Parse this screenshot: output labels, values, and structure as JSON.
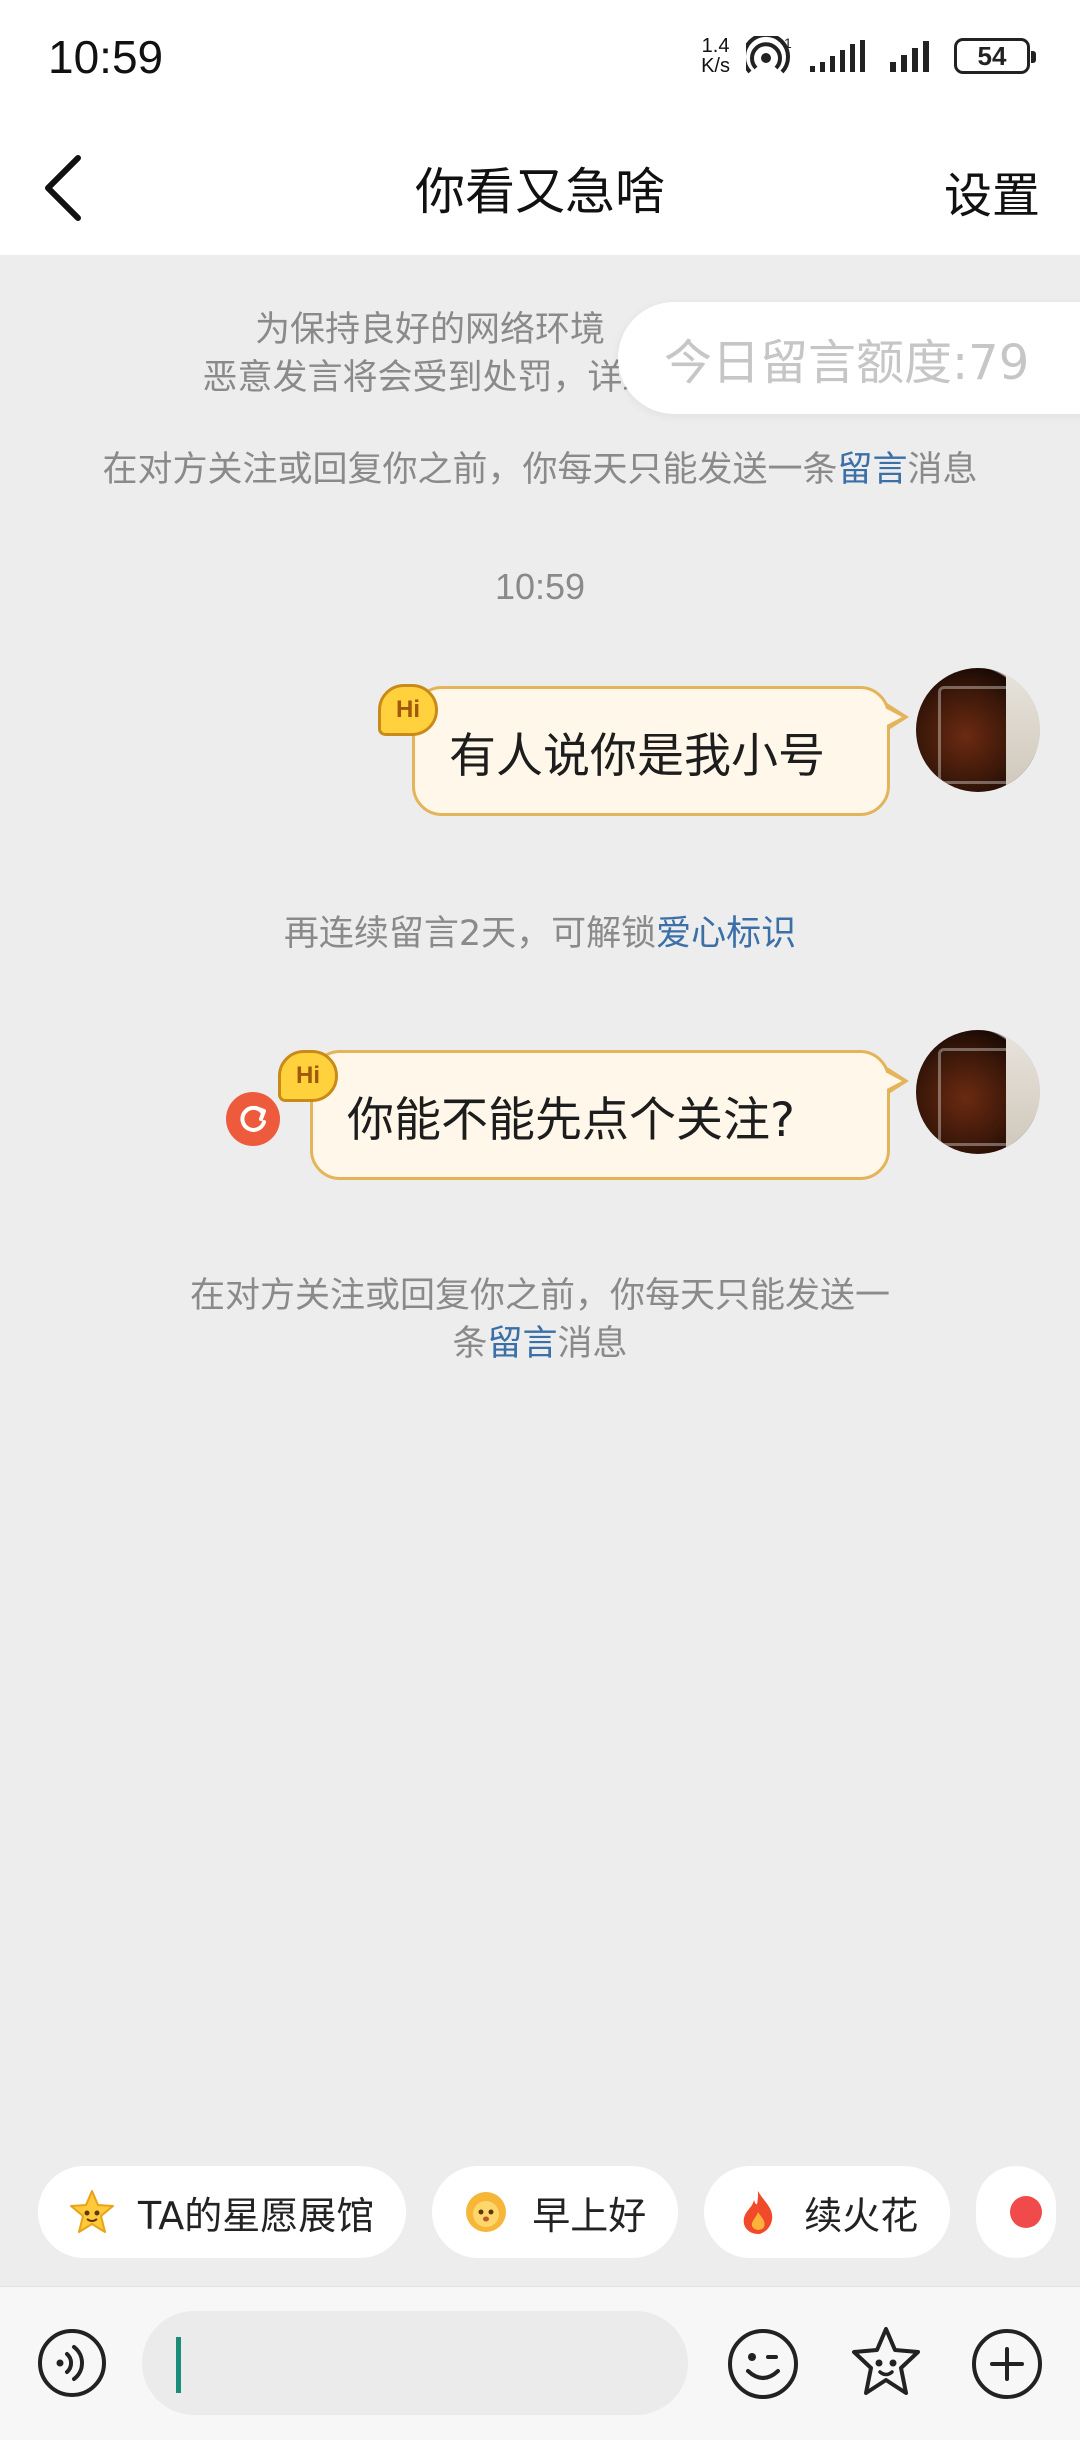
{
  "status_bar": {
    "time": "10:59",
    "net_speed_value": "1.4",
    "net_speed_unit": "K/s",
    "battery": "54"
  },
  "header": {
    "title": "你看又急啥",
    "settings": "设置"
  },
  "notices": {
    "policy_line1": "为保持良好的网络环境",
    "policy_line2": "恶意发言将会受到处罚，详细",
    "quota": "今日留言额度:79",
    "limit_prefix": "在对方关注或回复你之前，你每天只能发送一条",
    "limit_link": "留言",
    "limit_suffix": "消息",
    "timestamp": "10:59",
    "streak_prefix": "再连续留言2天，可解锁",
    "streak_link": "爱心标识",
    "limit2_line1": "在对方关注或回复你之前，你每天只能发送一",
    "limit2_prefix": "条",
    "limit2_link": "留言",
    "limit2_suffix": "消息"
  },
  "messages": [
    {
      "text": "有人说你是我小号",
      "badge": "Hi"
    },
    {
      "text": "你能不能先点个关注?",
      "badge": "Hi"
    }
  ],
  "quick_replies": [
    {
      "label": "TA的星愿展馆",
      "icon": "star-face-icon"
    },
    {
      "label": "早上好",
      "icon": "sun-face-icon"
    },
    {
      "label": "续火花",
      "icon": "flame-icon"
    }
  ],
  "input": {
    "placeholder": ""
  },
  "colors": {
    "link": "#3a6fa8",
    "bubble_bg": "#fff8ea",
    "bubble_border": "#e4b45a",
    "resend": "#ee5a3c",
    "caret": "#1a8c7a"
  }
}
